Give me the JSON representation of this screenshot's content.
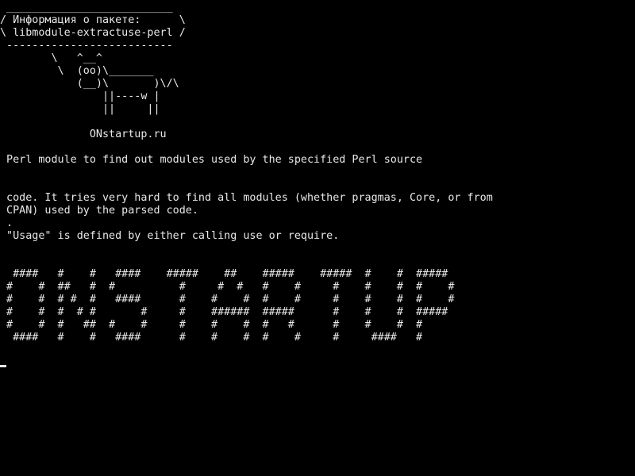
{
  "terminal": {
    "bubble": {
      "top_border": " __________________________",
      "line1": "/ Информация о пакете:      \\",
      "line2": "\\ libmodule-extractuse-perl /",
      "bottom_border": " --------------------------"
    },
    "cow": {
      "line1": "        \\   ^__^",
      "line2": "         \\  (oo)\\_______",
      "line3": "            (__)\\       )\\/\\",
      "line4": "                ||----w |",
      "line5": "                ||     ||"
    },
    "site": "              ONstartup.ru",
    "description": {
      "line1": " Perl module to find out modules used by the specified Perl source",
      "line2": " code. It tries very hard to find all modules (whether pragmas, Core, or from",
      "line3": " CPAN) used by the parsed code.",
      "line4": " .",
      "line5": " \"Usage\" is defined by either calling use or require."
    },
    "banner": {
      "line1": "  ####   #    #   ####    #####    ##    #####    #####  #    #  #####",
      "line2": " #    #  ##   #  #          #     #  #   #    #     #    #    #  #    #",
      "line3": " #    #  # #  #   ####      #    #    #  #    #     #    #    #  #    #",
      "line4": " #    #  #  # #       #     #    ######  #####      #    #    #  #####",
      "line5": " #    #  #   ##  #    #     #    #    #  #   #      #    #    #  #",
      "line6": "  ####   #    #   ####      #    #    #  #    #     #     ####   #"
    }
  }
}
